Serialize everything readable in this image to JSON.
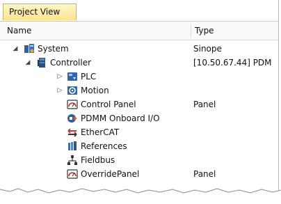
{
  "tab": {
    "label": "Project View"
  },
  "columns": {
    "name": "Name",
    "type": "Type"
  },
  "tree": [
    {
      "label": "System",
      "type": "Sinope",
      "expander": "◢",
      "icon": "system-icon"
    },
    {
      "label": "Controller",
      "type": "[10.50.67.44] PDM",
      "expander": "◢",
      "icon": "controller-icon"
    },
    {
      "label": "PLC",
      "type": "",
      "expander": "▷",
      "icon": "plc-icon"
    },
    {
      "label": "Motion",
      "type": "",
      "expander": "▷",
      "icon": "motion-icon"
    },
    {
      "label": "Control Panel",
      "type": "Panel",
      "expander": "",
      "icon": "control-panel-icon"
    },
    {
      "label": "PDMM Onboard I/O",
      "type": "",
      "expander": "",
      "icon": "onboard-io-icon"
    },
    {
      "label": "EtherCAT",
      "type": "",
      "expander": "",
      "icon": "ethercat-icon"
    },
    {
      "label": "References",
      "type": "",
      "expander": "",
      "icon": "references-icon"
    },
    {
      "label": "Fieldbus",
      "type": "",
      "expander": "",
      "icon": "fieldbus-icon"
    },
    {
      "label": "OverridePanel",
      "type": "Panel",
      "expander": "",
      "icon": "override-panel-icon"
    }
  ]
}
